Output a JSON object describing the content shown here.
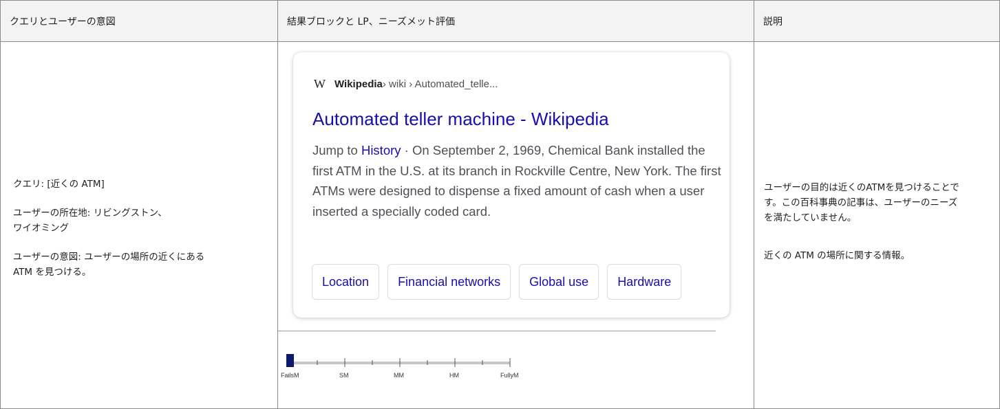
{
  "headers": {
    "col1": "クエリとユーザーの意図",
    "col2": "結果ブロックと LP、ニーズメット評価",
    "col3": "説明"
  },
  "query_cell": {
    "query": "クエリ: [近くの ATM]",
    "location": "ユーザーの所在地: リビングストン、\nワイオミング",
    "intent": "ユーザーの意図: ユーザーの場所の近くにある\nATM を見つける。"
  },
  "result": {
    "logo": "W",
    "site": "Wikipedia",
    "path": " › wiki › Automated_telle...",
    "title": "Automated teller machine - Wikipedia",
    "snippet_prefix": "Jump to ",
    "snippet_link": "History",
    "snippet_text": " · On September 2, 1969, Chemical Bank installed the first ATM in the U.S. at its branch in Rockville Centre, New York. The first ATMs were designed to dispense a fixed amount of cash when a user inserted a specially coded card.",
    "chips": [
      "Location",
      "Financial networks",
      "Global use",
      "Hardware"
    ]
  },
  "rating_scale": {
    "labels": [
      "FailsM",
      "SM",
      "MM",
      "HM",
      "FullyM"
    ],
    "selected": "FailsM",
    "selected_color": "#0b1a6b"
  },
  "explanation": {
    "line1": "ユーザーの目的は近くのATMを見つけることで\nす。この百科事典の記事は、ユーザーのニーズ\nを満たしていません。",
    "line2": "近くの ATM の場所に関する情報。"
  }
}
